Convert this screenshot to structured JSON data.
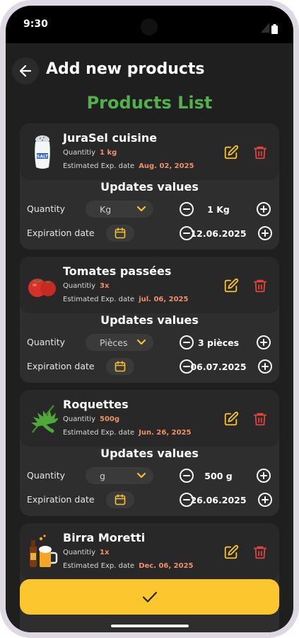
{
  "status_bar": {
    "time": "9:30"
  },
  "header": {
    "title": "Add new products"
  },
  "list_title": "Products List",
  "colors": {
    "accent_green": "#52b04d",
    "edit": "#f5c12e",
    "delete": "#e0443c",
    "highlight": "#f0906a",
    "confirm": "#fcc72e"
  },
  "labels": {
    "quantity_short": "Quantitiy",
    "exp_date": "Estimated Exp. date",
    "updates_values": "Updates values",
    "quantity": "Quantity",
    "expiration_date": "Expiration date"
  },
  "products": [
    {
      "name": "JuraSel cuisine",
      "icon": "salt-shaker-icon",
      "quantity": "1 kg",
      "exp": "Aug. 02, 2025",
      "unit": "Kg",
      "qty_value": "1 Kg",
      "date_value": "12.06.2025"
    },
    {
      "name": "Tomates passées",
      "icon": "tomato-icon",
      "quantity": "3x",
      "exp": "jul. 06, 2025",
      "unit": "Pièces",
      "qty_value": "3 pièces",
      "date_value": "06.07.2025"
    },
    {
      "name": "Roquettes",
      "icon": "arugula-icon",
      "quantity": "500g",
      "exp": "Jun. 26, 2025",
      "unit": "g",
      "qty_value": "500 g",
      "date_value": "26.06.2025"
    },
    {
      "name": "Birra Moretti",
      "icon": "beer-icon",
      "quantity": "1x",
      "exp": "Dec. 06, 2025"
    }
  ]
}
